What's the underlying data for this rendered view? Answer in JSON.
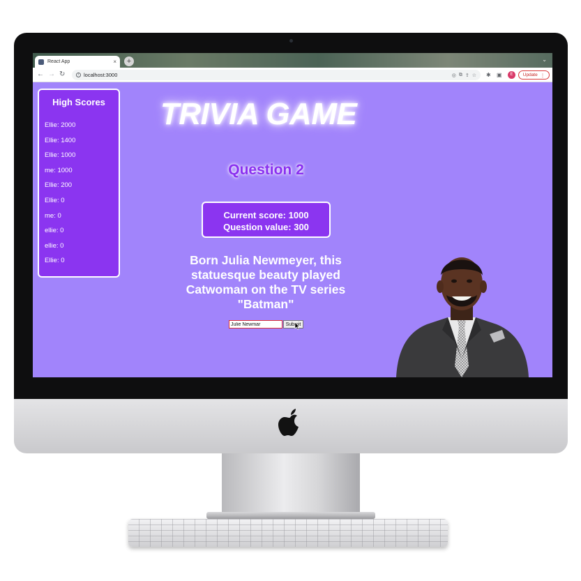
{
  "browser": {
    "tab_title": "React App",
    "tab_close": "×",
    "new_tab": "+",
    "url": "localhost:3000",
    "update_label": "Update",
    "profile_initial": "E",
    "menu_dots": "⋮"
  },
  "app": {
    "title": "TRIVIA GAME",
    "question_label": "Question 2",
    "score": {
      "current": "Current score: 1000",
      "value": "Question value: 300"
    },
    "clue": "Born Julia Newmeyer, this statuesque beauty played Catwoman on the TV series \"Batman\"",
    "answer_value": "Julie Newmar",
    "submit_label": "Submit"
  },
  "high_scores": {
    "title": "High Scores",
    "items": [
      "Ellie: 2000",
      "Ellie: 1400",
      "Ellie: 1000",
      "me: 1000",
      "Ellie: 200",
      "Ellie: 0",
      "me: 0",
      "ellie: 0",
      "ellie: 0",
      "Ellie: 0"
    ]
  },
  "colors": {
    "background": "#a184fb",
    "panel": "#8b35f0",
    "heading_purple": "#8a2ff0",
    "text": "#ffffff"
  },
  "icons": [
    "back-icon",
    "forward-icon",
    "reload-icon",
    "info-icon",
    "share-icon",
    "star-icon",
    "extensions-icon",
    "sidepanel-icon",
    "apple-logo-icon"
  ]
}
